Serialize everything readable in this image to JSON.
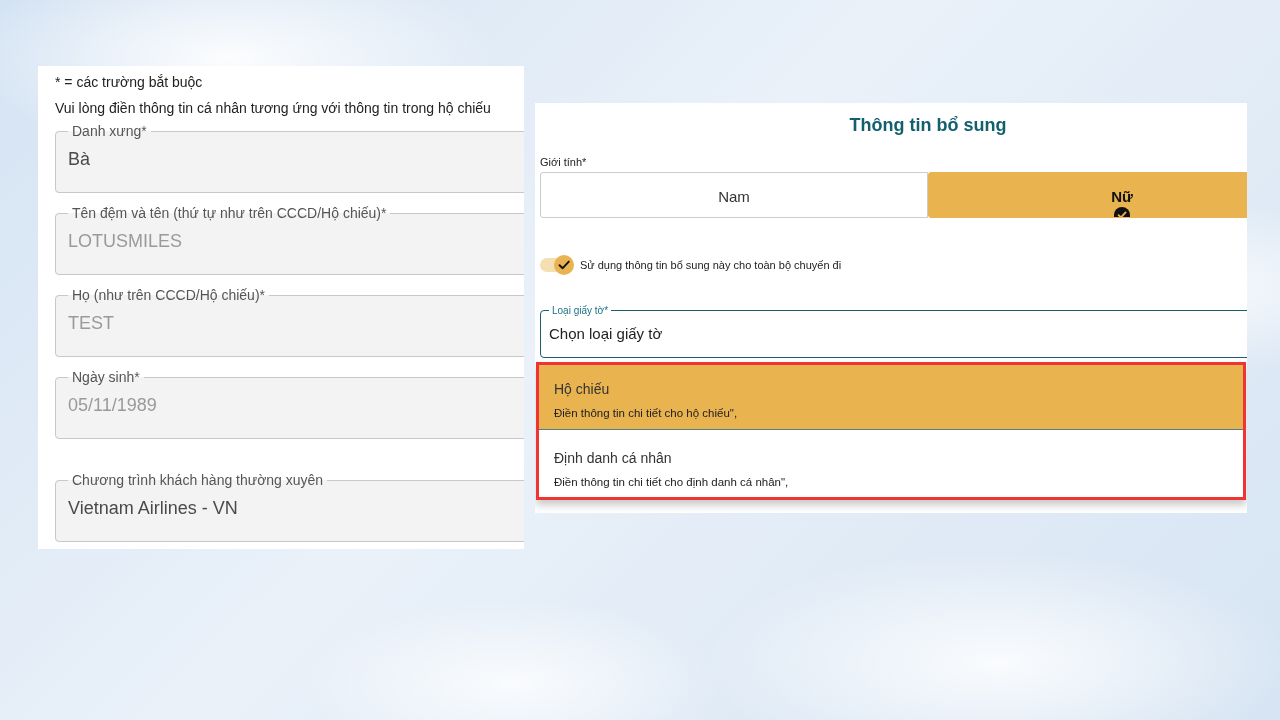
{
  "form": {
    "required_note": "* = các trường bắt buộc",
    "instruction": "Vui lòng điền thông tin cá nhân tương ứng với thông tin trong hộ chiếu",
    "fields": [
      {
        "label": "Danh xưng*",
        "value": "Bà",
        "disabled": false
      },
      {
        "label": "Tên đệm và tên (thứ tự như trên CCCD/Hộ chiếu)*",
        "value": "LOTUSMILES",
        "disabled": true
      },
      {
        "label": "Họ (như trên CCCD/Hộ chiếu)*",
        "value": "TEST",
        "disabled": true
      },
      {
        "label": "Ngày sinh*",
        "value": "05/11/1989",
        "disabled": true
      }
    ],
    "frequent_flyer": {
      "label": "Chương trình khách hàng thường xuyên",
      "value": "Vietnam Airlines - VN"
    }
  },
  "additional_info": {
    "title": "Thông tin bổ sung",
    "gender": {
      "label": "Giới tính*",
      "options": [
        {
          "label": "Nam",
          "selected": false
        },
        {
          "label": "Nữ",
          "selected": true
        }
      ]
    },
    "apply_to_all": {
      "label": "Sử dụng thông tin bổ sung này cho toàn bộ chuyến đi",
      "on": true
    },
    "document_type": {
      "label": "Loại giấy tờ*",
      "value": "Chọn loại giấy tờ",
      "expanded": true,
      "highlighted": true,
      "options": [
        {
          "title": "Hộ chiếu",
          "description": "Điền thông tin chi tiết cho hộ chiếu\",",
          "selected": true
        },
        {
          "title": "Định danh cá nhân",
          "description": "Điền thông tin chi tiết cho định danh cá nhân\",",
          "selected": false
        }
      ]
    }
  }
}
